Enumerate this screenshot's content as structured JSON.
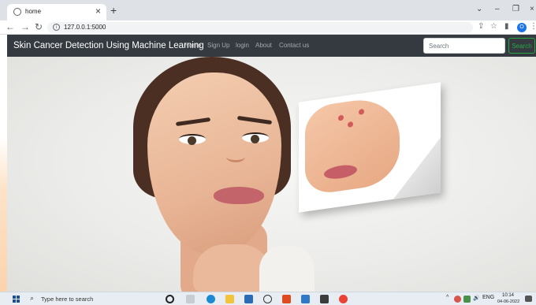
{
  "browser": {
    "tab_title": "home",
    "url": "127.0.0.1:5000",
    "tab_close": "×",
    "new_tab": "+"
  },
  "navbar": {
    "brand": "Skin Cancer Detection Using Machine Learning",
    "links": [
      "Home",
      "Sign Up",
      "login",
      "About",
      "Contact us"
    ],
    "search_placeholder": "Search",
    "search_button": "Search"
  },
  "taskbar": {
    "search_placeholder": "Type here to search",
    "language": "ENG",
    "time": "10:14",
    "date": "04-06-2022"
  },
  "colors": {
    "navbar_bg": "#343a40",
    "search_button_border": "#28a745",
    "profile_accent": "#1a73e8"
  }
}
